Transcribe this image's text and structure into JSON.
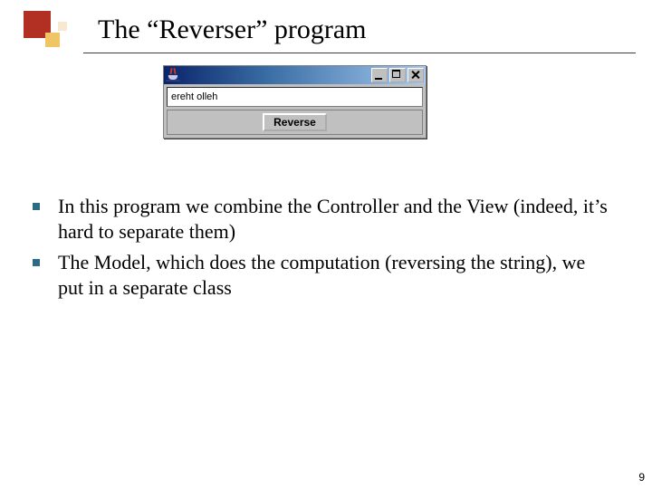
{
  "title": "The “Reverser” program",
  "window": {
    "textfield_value": "ereht olleh",
    "button_label": "Reverse"
  },
  "bullets": [
    "In this program we combine the Controller and the View (indeed, it’s hard to separate them)",
    "The Model, which does the computation (reversing the string), we put in a separate class"
  ],
  "page_number": "9"
}
